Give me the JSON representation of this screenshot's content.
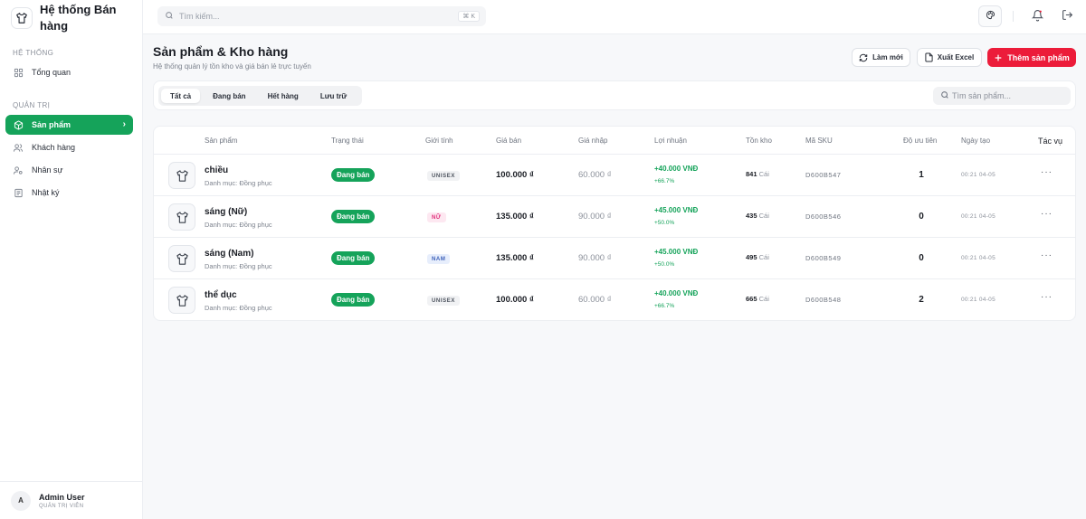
{
  "sidebar": {
    "brand": "Hệ thống Bán hàng",
    "section_system": "HỆ THỐNG",
    "section_admin": "QUẢN TRỊ",
    "items": [
      {
        "label": "Tổng quan",
        "icon": "grid-icon"
      },
      {
        "label": "Sản phẩm",
        "icon": "box-icon",
        "active": true
      },
      {
        "label": "Khách hàng",
        "icon": "users-icon"
      },
      {
        "label": "Nhân sự",
        "icon": "user-cog-icon"
      },
      {
        "label": "Nhật ký",
        "icon": "log-icon"
      }
    ],
    "user": {
      "initial": "A",
      "name": "Admin User",
      "role": "QUẢN TRỊ VIÊN"
    }
  },
  "topbar": {
    "search_placeholder": "Tìm kiếm...",
    "shortcut": "⌘ K"
  },
  "page": {
    "title": "Sản phẩm & Kho hàng",
    "subtitle": "Hệ thống quản lý tồn kho và giá bán lẻ trực tuyến",
    "refresh_label": "Làm mới",
    "export_label": "Xuất Excel",
    "add_label": "Thêm sản phẩm"
  },
  "filters": {
    "tabs": [
      "Tất cả",
      "Đang bán",
      "Hết hàng",
      "Lưu trữ"
    ],
    "active_tab": 0,
    "search_placeholder": "Tìm sản phẩm..."
  },
  "table": {
    "columns": [
      "Sản phẩm",
      "Trạng thái",
      "Giới tính",
      "Giá bán",
      "Giá nhập",
      "Lợi nhuận",
      "Tồn kho",
      "Mã SKU",
      "Độ ưu tiên",
      "Ngày tạo",
      "Tác vụ"
    ],
    "rows": [
      {
        "name": "chiều",
        "category": "Danh mục: Đồng phục",
        "status": "Đang bán",
        "gender": "UNISEX",
        "price": "100.000 ₫",
        "cost": "60.000 ₫",
        "profit": "+40.000 VNĐ",
        "margin": "+66.7%",
        "stock": "841",
        "unit": "Cái",
        "sku": "D600B547",
        "priority": "1",
        "created": "00:21 04-05"
      },
      {
        "name": "sáng (Nữ)",
        "category": "Danh mục: Đồng phục",
        "status": "Đang bán",
        "gender": "NỮ",
        "price": "135.000 ₫",
        "cost": "90.000 ₫",
        "profit": "+45.000 VNĐ",
        "margin": "+50.0%",
        "stock": "435",
        "unit": "Cái",
        "sku": "D600B546",
        "priority": "0",
        "created": "00:21 04-05"
      },
      {
        "name": "sáng (Nam)",
        "category": "Danh mục: Đồng phục",
        "status": "Đang bán",
        "gender": "NAM",
        "price": "135.000 ₫",
        "cost": "90.000 ₫",
        "profit": "+45.000 VNĐ",
        "margin": "+50.0%",
        "stock": "495",
        "unit": "Cái",
        "sku": "D600B549",
        "priority": "0",
        "created": "00:21 04-05"
      },
      {
        "name": "thể dục",
        "category": "Danh mục: Đồng phục",
        "status": "Đang bán",
        "gender": "UNISEX",
        "price": "100.000 ₫",
        "cost": "60.000 ₫",
        "profit": "+40.000 VNĐ",
        "margin": "+66.7%",
        "stock": "665",
        "unit": "Cái",
        "sku": "D600B548",
        "priority": "2",
        "created": "00:21 04-05"
      }
    ]
  },
  "colors": {
    "accent": "#15a35a",
    "danger": "#ec1c3a"
  }
}
